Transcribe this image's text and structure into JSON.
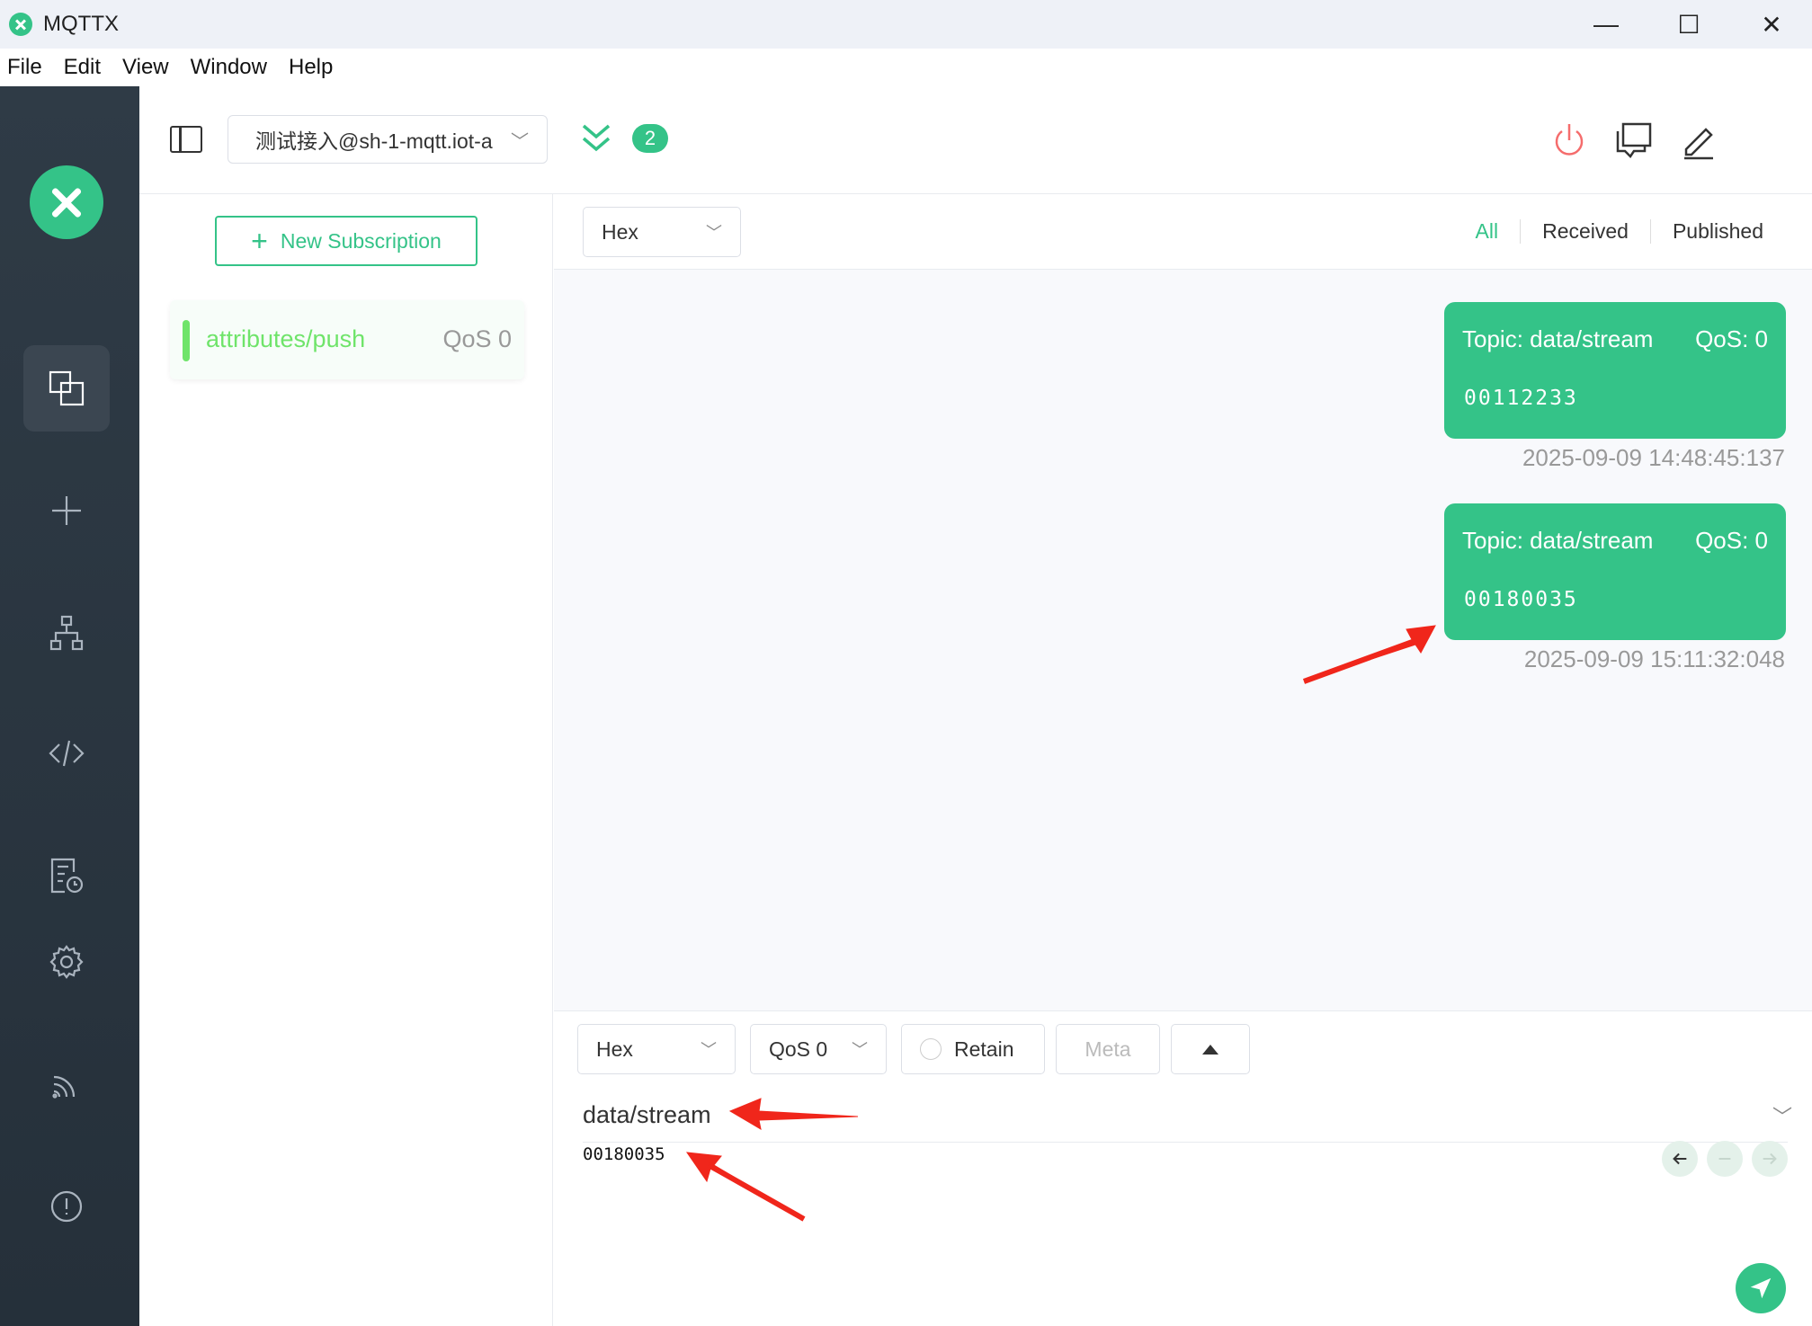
{
  "window": {
    "title": "MQTTX",
    "minimize": "—",
    "maximize": "☐",
    "close": "✕"
  },
  "menu": [
    "File",
    "Edit",
    "View",
    "Window",
    "Help"
  ],
  "toolbar": {
    "connection_name": "测试接入@sh-1-mqtt.iot-a",
    "subscription_count": "2"
  },
  "subscriptions": {
    "new_button": "New Subscription",
    "items": [
      {
        "topic": "attributes/push",
        "qos": "QoS 0",
        "color": "#6fe46a"
      }
    ]
  },
  "messages": {
    "format": "Hex",
    "tabs": [
      "All",
      "Received",
      "Published"
    ],
    "active_tab": "All",
    "items": [
      {
        "topic": "Topic: data/stream",
        "qos": "QoS: 0",
        "payload": "00112233",
        "time": "2025-09-09 14:48:45:137"
      },
      {
        "topic": "Topic: data/stream",
        "qos": "QoS: 0",
        "payload": "00180035",
        "time": "2025-09-09 15:11:32:048"
      }
    ]
  },
  "publish": {
    "format": "Hex",
    "qos": "QoS 0",
    "retain_label": "Retain",
    "meta_label": "Meta",
    "topic": "data/stream",
    "payload": "00180035"
  },
  "colors": {
    "accent": "#34c388",
    "nav_bg": "#2f3b46",
    "annotation": "#f0261b"
  }
}
